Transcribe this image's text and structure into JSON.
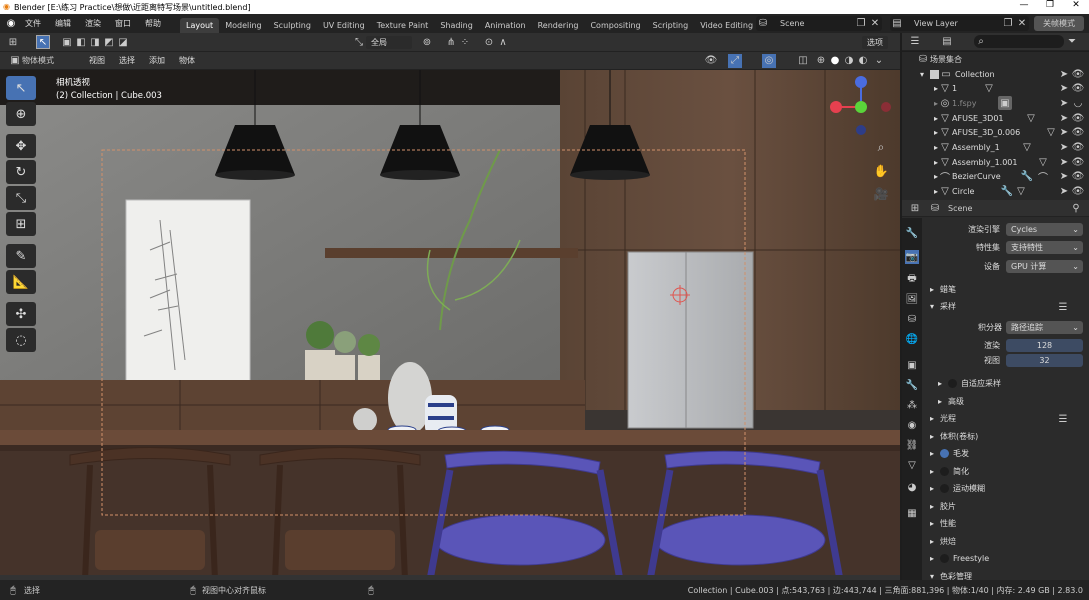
{
  "window": {
    "title": "Blender [E:\\练习 Practice\\想做\\近距离特写场景\\untitled.blend]"
  },
  "menu": [
    "文件",
    "编辑",
    "渲染",
    "窗口",
    "帮助"
  ],
  "workspace_tabs": [
    "Layout",
    "Modeling",
    "Sculpting",
    "UV Editing",
    "Texture Paint",
    "Shading",
    "Animation",
    "Rendering",
    "Compositing",
    "Scripting",
    "Video Editing"
  ],
  "active_tab": "Layout",
  "scene_field": "Scene",
  "view_layer_field": "View Layer",
  "render_mode_btn": "关帧模式",
  "viewport_header": {
    "pivot": "全局",
    "options": "选项"
  },
  "mode_header": {
    "mode": "物体模式",
    "menus": [
      "视图",
      "选择",
      "添加",
      "物体"
    ]
  },
  "viewport": {
    "camera_label": "相机透视",
    "collection_label": "(2) Collection | Cube.003"
  },
  "outliner": {
    "title": "场景集合",
    "items": [
      {
        "name": "Collection"
      },
      {
        "name": "1"
      },
      {
        "name": "1.fspy"
      },
      {
        "name": "AFUSE_3D01"
      },
      {
        "name": "AFUSE_3D_0.006"
      },
      {
        "name": "Assembly_1"
      },
      {
        "name": "Assembly_1.001"
      },
      {
        "name": "BezierCurve"
      },
      {
        "name": "Circle"
      }
    ]
  },
  "properties": {
    "scene": "Scene",
    "engine_label": "渲染引擎",
    "engine": "Cycles",
    "feature_label": "特性集",
    "feature": "支持特性",
    "device_label": "设备",
    "device": "GPU 计算",
    "panels": {
      "pencil": "蜡笔",
      "sampling": "采样",
      "integrator_label": "积分器",
      "integrator": "路径追踪",
      "render_label": "渲染",
      "render_samples": "128",
      "viewport_label": "视图",
      "viewport_samples": "32",
      "adaptive": "自适应采样",
      "advanced": "高级",
      "light_paths": "光程",
      "volumes": "体积(卷标)",
      "hair": "毛发",
      "simplify": "简化",
      "motion_blur": "运动模糊",
      "film": "胶片",
      "performance": "性能",
      "bake": "烘焙",
      "freestyle": "Freestyle",
      "color_mgmt": "色彩管理"
    }
  },
  "statusbar": {
    "select": "选择",
    "center": "视图中心对齐鼠标",
    "stats": "Collection | Cube.003 | 点:543,763 | 边:443,744 | 三角面:881,396 | 物体:1/40 | 内存: 2.49 GB | 2.83.0"
  },
  "colors": {
    "accent": "#4772b3",
    "chair_blue": "#5a55b8",
    "axis_x": "#e5404f",
    "axis_y": "#5ad43a",
    "axis_z": "#4a6ce0"
  }
}
